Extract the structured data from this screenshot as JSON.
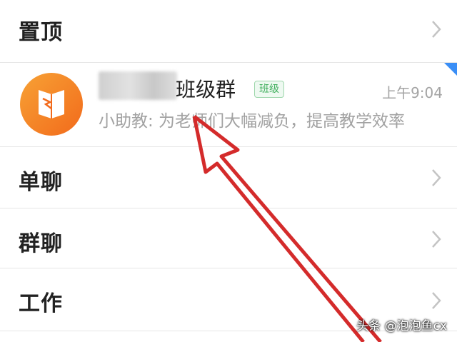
{
  "sections": {
    "pinned_label": "置顶",
    "single_chat_label": "单聊",
    "group_chat_label": "群聊",
    "work_label": "工作"
  },
  "chat_item": {
    "title_suffix": "班级群",
    "badge": "班级",
    "time": "上午9:04",
    "preview": "小助教: 为老师们大幅减负，提高教学效率"
  },
  "watermark": "头条 @泡泡鱼cx",
  "colors": {
    "avatar_gradient_start": "#f7a235",
    "avatar_gradient_end": "#f26a1b",
    "badge_green": "#3fae5c",
    "arrow_red": "#d42b2b",
    "corner_blue": "#3a8ef6"
  },
  "icons": {
    "avatar": "class-book-icon",
    "chevron": "chevron-right-icon"
  }
}
